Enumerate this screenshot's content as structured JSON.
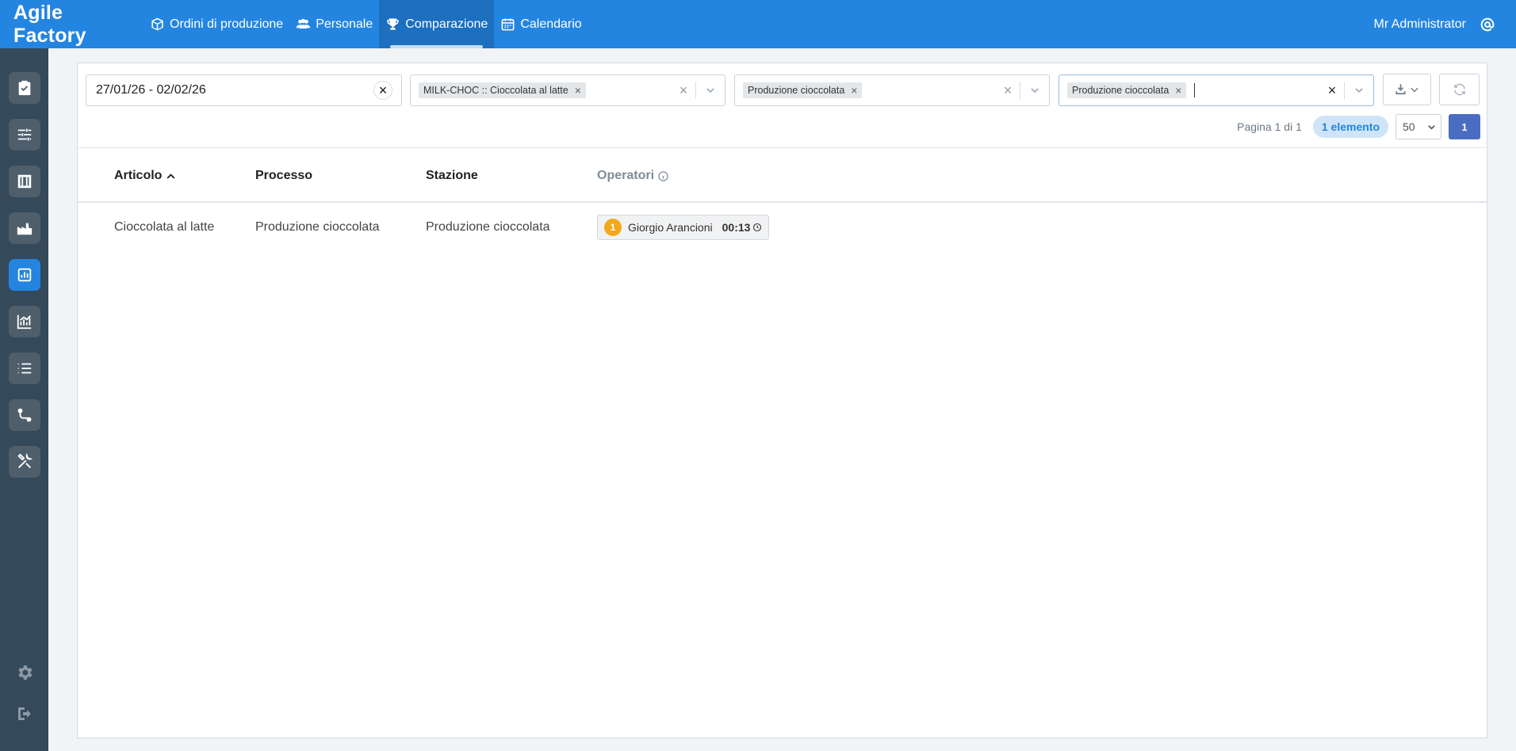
{
  "app": {
    "title": "Agile Factory"
  },
  "nav": [
    {
      "label": "Ordini di produzione",
      "icon": "box-icon",
      "active": false
    },
    {
      "label": "Personale",
      "icon": "users-icon",
      "active": false
    },
    {
      "label": "Comparazione",
      "icon": "trophy-icon",
      "active": true
    },
    {
      "label": "Calendario",
      "icon": "calendar-icon",
      "active": false
    }
  ],
  "user": {
    "name": "Mr Administrator",
    "icon": "account-at-icon"
  },
  "sidebar": {
    "items": [
      {
        "icon": "clipboard-check-icon",
        "active": false
      },
      {
        "icon": "sliders-icon",
        "active": false
      },
      {
        "icon": "warehouse-icon",
        "active": false
      },
      {
        "icon": "factory-icon",
        "active": false
      },
      {
        "icon": "bar-chart-icon",
        "active": true
      },
      {
        "icon": "analytics-chart-icon",
        "active": false
      },
      {
        "icon": "list-icon",
        "active": false
      },
      {
        "icon": "workflow-icon",
        "active": false
      },
      {
        "icon": "tools-icon",
        "active": false
      }
    ],
    "bottom": [
      {
        "icon": "settings-gear-icon"
      },
      {
        "icon": "logout-icon"
      }
    ]
  },
  "filters": {
    "date_range": "27/01/26 - 02/02/26",
    "article_tag": "MILK-CHOC :: Cioccolata al latte",
    "process_tag": "Produzione cioccolata",
    "station_tag": "Produzione cioccolata",
    "tag_remove": "×",
    "clear": "×"
  },
  "pagination": {
    "page_text": "Pagina 1 di 1",
    "count_badge": "1 elemento",
    "page_size": "50",
    "current_page": "1"
  },
  "table": {
    "columns": [
      "Articolo",
      "Processo",
      "Stazione",
      "Operatori"
    ],
    "rows": [
      {
        "articolo": "Cioccolata al latte",
        "processo": "Produzione cioccolata",
        "stazione": "Produzione cioccolata",
        "operator": {
          "rank": "1",
          "name": "Giorgio Arancioni",
          "time": "00:13"
        }
      }
    ]
  },
  "colors": {
    "primary": "#2485e0",
    "sidebar": "#34495a",
    "rank": "#f2a81c",
    "page_button": "#4a6dc2"
  }
}
